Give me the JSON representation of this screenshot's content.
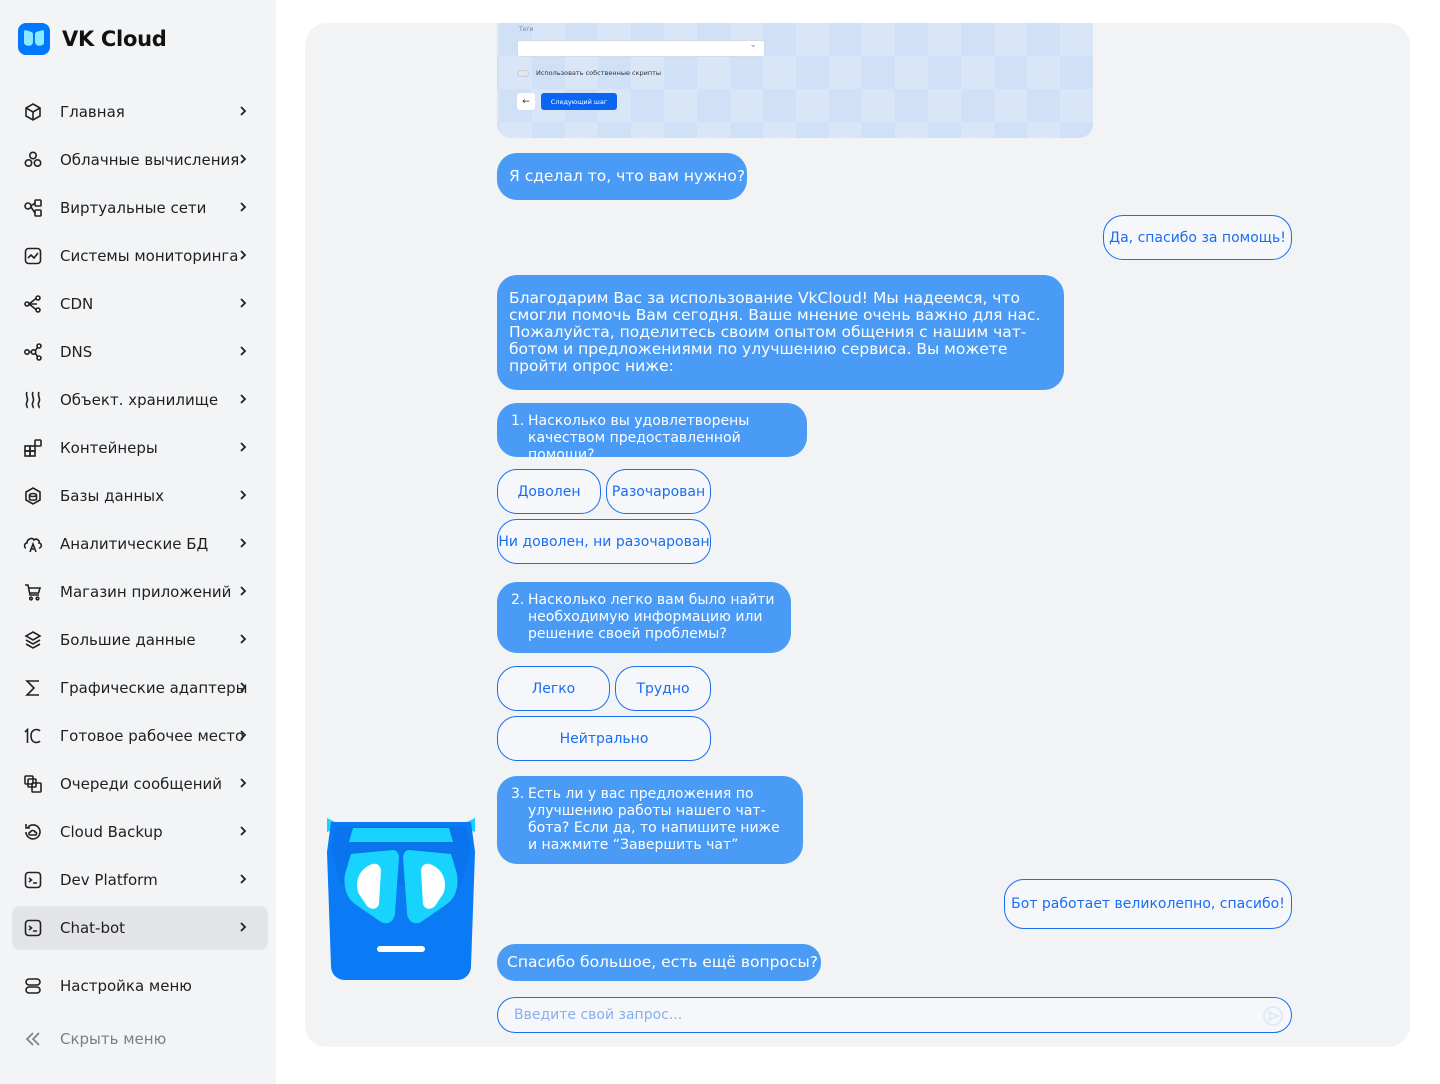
{
  "brand": {
    "name": "VK Cloud"
  },
  "sidebar": {
    "items": [
      {
        "label": "Главная",
        "icon": "cube-icon"
      },
      {
        "label": "Облачные вычисления",
        "icon": "cloud-compute-icon"
      },
      {
        "label": "Виртуальные сети",
        "icon": "network-icon"
      },
      {
        "label": "Системы мониторинга",
        "icon": "monitoring-icon"
      },
      {
        "label": "CDN",
        "icon": "cdn-icon"
      },
      {
        "label": "DNS",
        "icon": "dns-icon"
      },
      {
        "label": "Объект. хранилище",
        "icon": "storage-icon"
      },
      {
        "label": "Контейнеры",
        "icon": "containers-icon"
      },
      {
        "label": "Базы данных",
        "icon": "database-icon"
      },
      {
        "label": "Аналитические БД",
        "icon": "analytics-db-icon"
      },
      {
        "label": "Магазин приложений",
        "icon": "cart-icon"
      },
      {
        "label": "Большие данные",
        "icon": "layers-icon"
      },
      {
        "label": "Графические адаптеры",
        "icon": "sigma-icon"
      },
      {
        "label": "Готовое рабочее место",
        "icon": "one-c-icon"
      },
      {
        "label": "Очереди сообщений",
        "icon": "queue-icon"
      },
      {
        "label": "Cloud Backup",
        "icon": "backup-icon"
      },
      {
        "label": "Dev Platform",
        "icon": "terminal-icon"
      },
      {
        "label": "Chat-bot",
        "icon": "terminal-icon",
        "active": true
      }
    ],
    "settings_label": "Настройка меню",
    "hide_label": "Скрыть меню"
  },
  "screenshot": {
    "tags_label": "Теги",
    "toggle_label": "Использовать собственные скрипты",
    "back_label": "←",
    "next_label": "Следующий шаг"
  },
  "chat": {
    "bot_done": "Я сделал то, что вам нужно?",
    "user_thanks": "Да, спасибо за помощь!",
    "bot_survey": "Благодарим Вас за использование VkCloud! Мы надеемся, что смогли помочь Вам сегодня. Ваше мнение очень важно для нас. Пожалуйста, поделитесь своим опытом общения с нашим чат-ботом и предложениями по улучшению сервиса. Вы можете пройти опрос ниже:",
    "q1": {
      "num": "1.",
      "text": "Насколько вы удовлетворены качеством предоставленной помощи?"
    },
    "q1_options": [
      "Доволен",
      "Разочарован",
      "Ни доволен, ни разочарован"
    ],
    "q2": {
      "num": "2.",
      "text": "Насколько легко вам было найти необходимую информацию или решение своей проблемы?"
    },
    "q2_options": [
      "Легко",
      "Трудно",
      "Нейтрально"
    ],
    "q3": {
      "num": "3.",
      "text": "Есть ли у вас предложения по улучшению работы нашего чат-бота? Если да, то напишите ниже и нажмите “Завершить чат”"
    },
    "user_feedback": "Бот работает великолепно, спасибо!",
    "bot_final": "Спасибо большое, есть ещё вопросы?",
    "input_placeholder": "Введите свой запрос..."
  },
  "colors": {
    "accent": "#1a6ef0",
    "bot_bubble": "#4a9bf5",
    "mascot_blue": "#0a7af5",
    "mascot_cyan": "#19d3ff"
  }
}
